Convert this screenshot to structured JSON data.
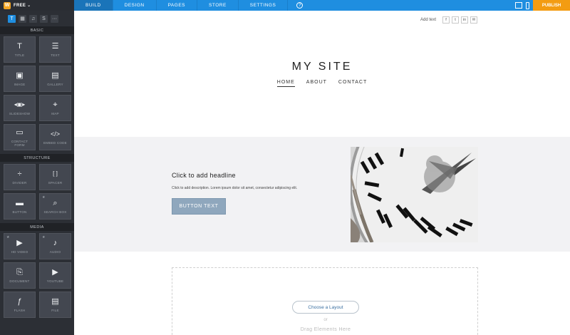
{
  "topbar": {
    "plan_label": "FREE ⌄",
    "tabs": [
      {
        "label": "BUILD",
        "active": true
      },
      {
        "label": "DESIGN",
        "active": false
      },
      {
        "label": "PAGES",
        "active": false
      },
      {
        "label": "STORE",
        "active": false
      },
      {
        "label": "SETTINGS",
        "active": false
      }
    ],
    "help_glyph": "?",
    "publish_label": "PUBLISH"
  },
  "sidebar": {
    "tool_tabs": [
      {
        "glyph": "T",
        "active": true
      },
      {
        "glyph": "▦",
        "active": false
      },
      {
        "glyph": "♫",
        "active": false
      },
      {
        "glyph": "S",
        "active": false
      },
      {
        "glyph": "···",
        "active": false
      }
    ],
    "sections": [
      {
        "title": "BASIC",
        "tiles": [
          {
            "label": "TITLE",
            "icon": "title-icon",
            "glyph": "T"
          },
          {
            "label": "TEXT",
            "icon": "text-icon",
            "glyph": "☰"
          },
          {
            "label": "IMAGE",
            "icon": "image-icon",
            "glyph": "▣"
          },
          {
            "label": "GALLERY",
            "icon": "gallery-icon",
            "glyph": "▤"
          },
          {
            "label": "SLIDESHOW",
            "icon": "slideshow-icon",
            "glyph": "◂▣▸"
          },
          {
            "label": "MAP",
            "icon": "map-icon",
            "glyph": "⌖"
          },
          {
            "label": "CONTACT FORM",
            "icon": "contact-form-icon",
            "glyph": "▭"
          },
          {
            "label": "EMBED CODE",
            "icon": "embed-code-icon",
            "glyph": "</>"
          }
        ]
      },
      {
        "title": "STRUCTURE",
        "tiles": [
          {
            "label": "DIVIDER",
            "icon": "divider-icon",
            "glyph": "÷"
          },
          {
            "label": "SPACER",
            "icon": "spacer-icon",
            "glyph": "[ ]"
          },
          {
            "label": "BUTTON",
            "icon": "button-icon",
            "glyph": "▬"
          },
          {
            "label": "SEARCH BOX",
            "icon": "search-box-icon",
            "glyph": "⌕",
            "star": true
          }
        ]
      },
      {
        "title": "MEDIA",
        "tiles": [
          {
            "label": "HD VIDEO",
            "icon": "hd-video-icon",
            "glyph": "▶",
            "star": true
          },
          {
            "label": "AUDIO",
            "icon": "audio-icon",
            "glyph": "♪",
            "star": true
          },
          {
            "label": "DOCUMENT",
            "icon": "document-icon",
            "glyph": "⎘"
          },
          {
            "label": "YOUTUBE",
            "icon": "youtube-icon",
            "glyph": "▶"
          },
          {
            "label": "FLASH",
            "icon": "flash-icon",
            "glyph": "ƒ"
          },
          {
            "label": "FILE",
            "icon": "file-icon",
            "glyph": "▤"
          }
        ]
      }
    ]
  },
  "canvas": {
    "header": {
      "add_text": "Add text",
      "social": [
        "f",
        "t",
        "in",
        "✉"
      ]
    },
    "site_title": "MY SITE",
    "site_nav": [
      {
        "label": "HOME",
        "active": true
      },
      {
        "label": "ABOUT",
        "active": false
      },
      {
        "label": "CONTACT",
        "active": false
      }
    ],
    "band": {
      "headline": "Click to add headline",
      "description": "Click to add description. Lorem ipsum dolor sit amet, consectetur adipiscing elit.",
      "button_label": "BUTTON TEXT"
    },
    "layout": {
      "choose_label": "Choose a Layout",
      "or_label": "or",
      "drag_label": "Drag Elements Here"
    }
  }
}
